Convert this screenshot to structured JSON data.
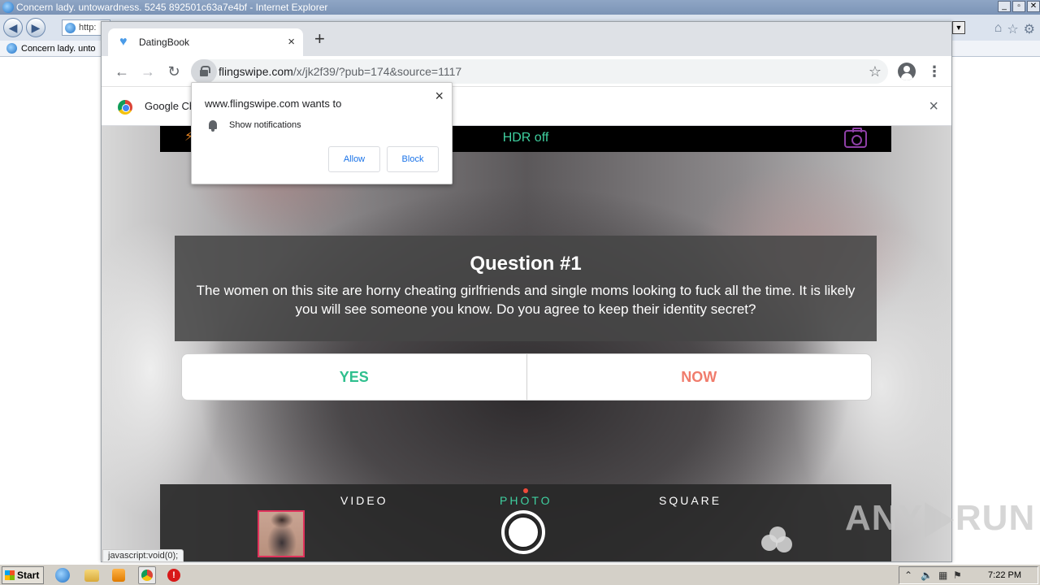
{
  "ie": {
    "title": "Concern lady. untowardness. 5245 892501c63a7e4bf - Internet Explorer",
    "address_partial": "http:",
    "tab_label": "Concern lady. unto",
    "controls": [
      "_",
      "▫",
      "✕"
    ]
  },
  "chrome": {
    "tab_title": "DatingBook",
    "tab_close": "×",
    "new_tab": "+",
    "url_domain": "flingswipe.com",
    "url_path": "/x/jk2f39/?pub=174&source=1117",
    "infobar_text": "Google Ch",
    "infobar_close": "×"
  },
  "permission_popup": {
    "title": "www.flingswipe.com wants to",
    "permission": "Show notifications",
    "allow_label": "Allow",
    "block_label": "Block",
    "close": "×"
  },
  "camera": {
    "hdr_label": "HDR off",
    "modes": [
      "VIDEO",
      "PHOTO",
      "SQUARE"
    ],
    "active_mode": "PHOTO",
    "colors": {
      "accent": "#3fd0a0",
      "flash": "#f08a24",
      "switch": "#8e3fa6"
    }
  },
  "question": {
    "title": "Question #1",
    "text": "The women on this site are horny cheating girlfriends and single moms looking to fuck all the time. It is likely you will see someone you know. Do you agree to keep their identity secret?",
    "yes_label": "YES",
    "now_label": "NOW"
  },
  "status_bar_text": "javascript:void(0);",
  "watermark": {
    "left": "ANY",
    "right": "RUN"
  },
  "taskbar": {
    "start_label": "Start",
    "clock": "7:22 PM"
  }
}
